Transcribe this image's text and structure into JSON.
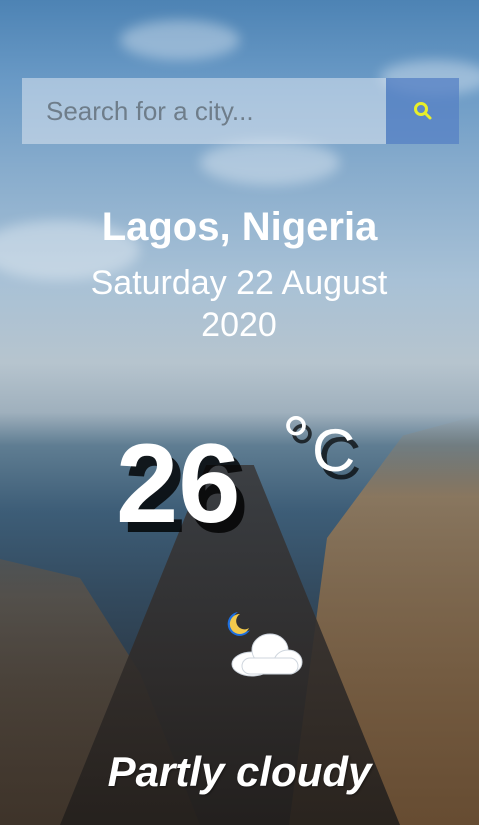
{
  "search": {
    "placeholder": "Search for a city...",
    "button_icon": "search-icon",
    "button_color": "#5680c4",
    "icon_color": "#e8ef2a"
  },
  "location": "Lagos, Nigeria",
  "date": "Saturday 22 August 2020",
  "temperature": {
    "value": "26",
    "degree": "°",
    "unit": "C"
  },
  "condition": {
    "icon": "partly-cloudy-night-icon",
    "description": "Partly cloudy"
  }
}
